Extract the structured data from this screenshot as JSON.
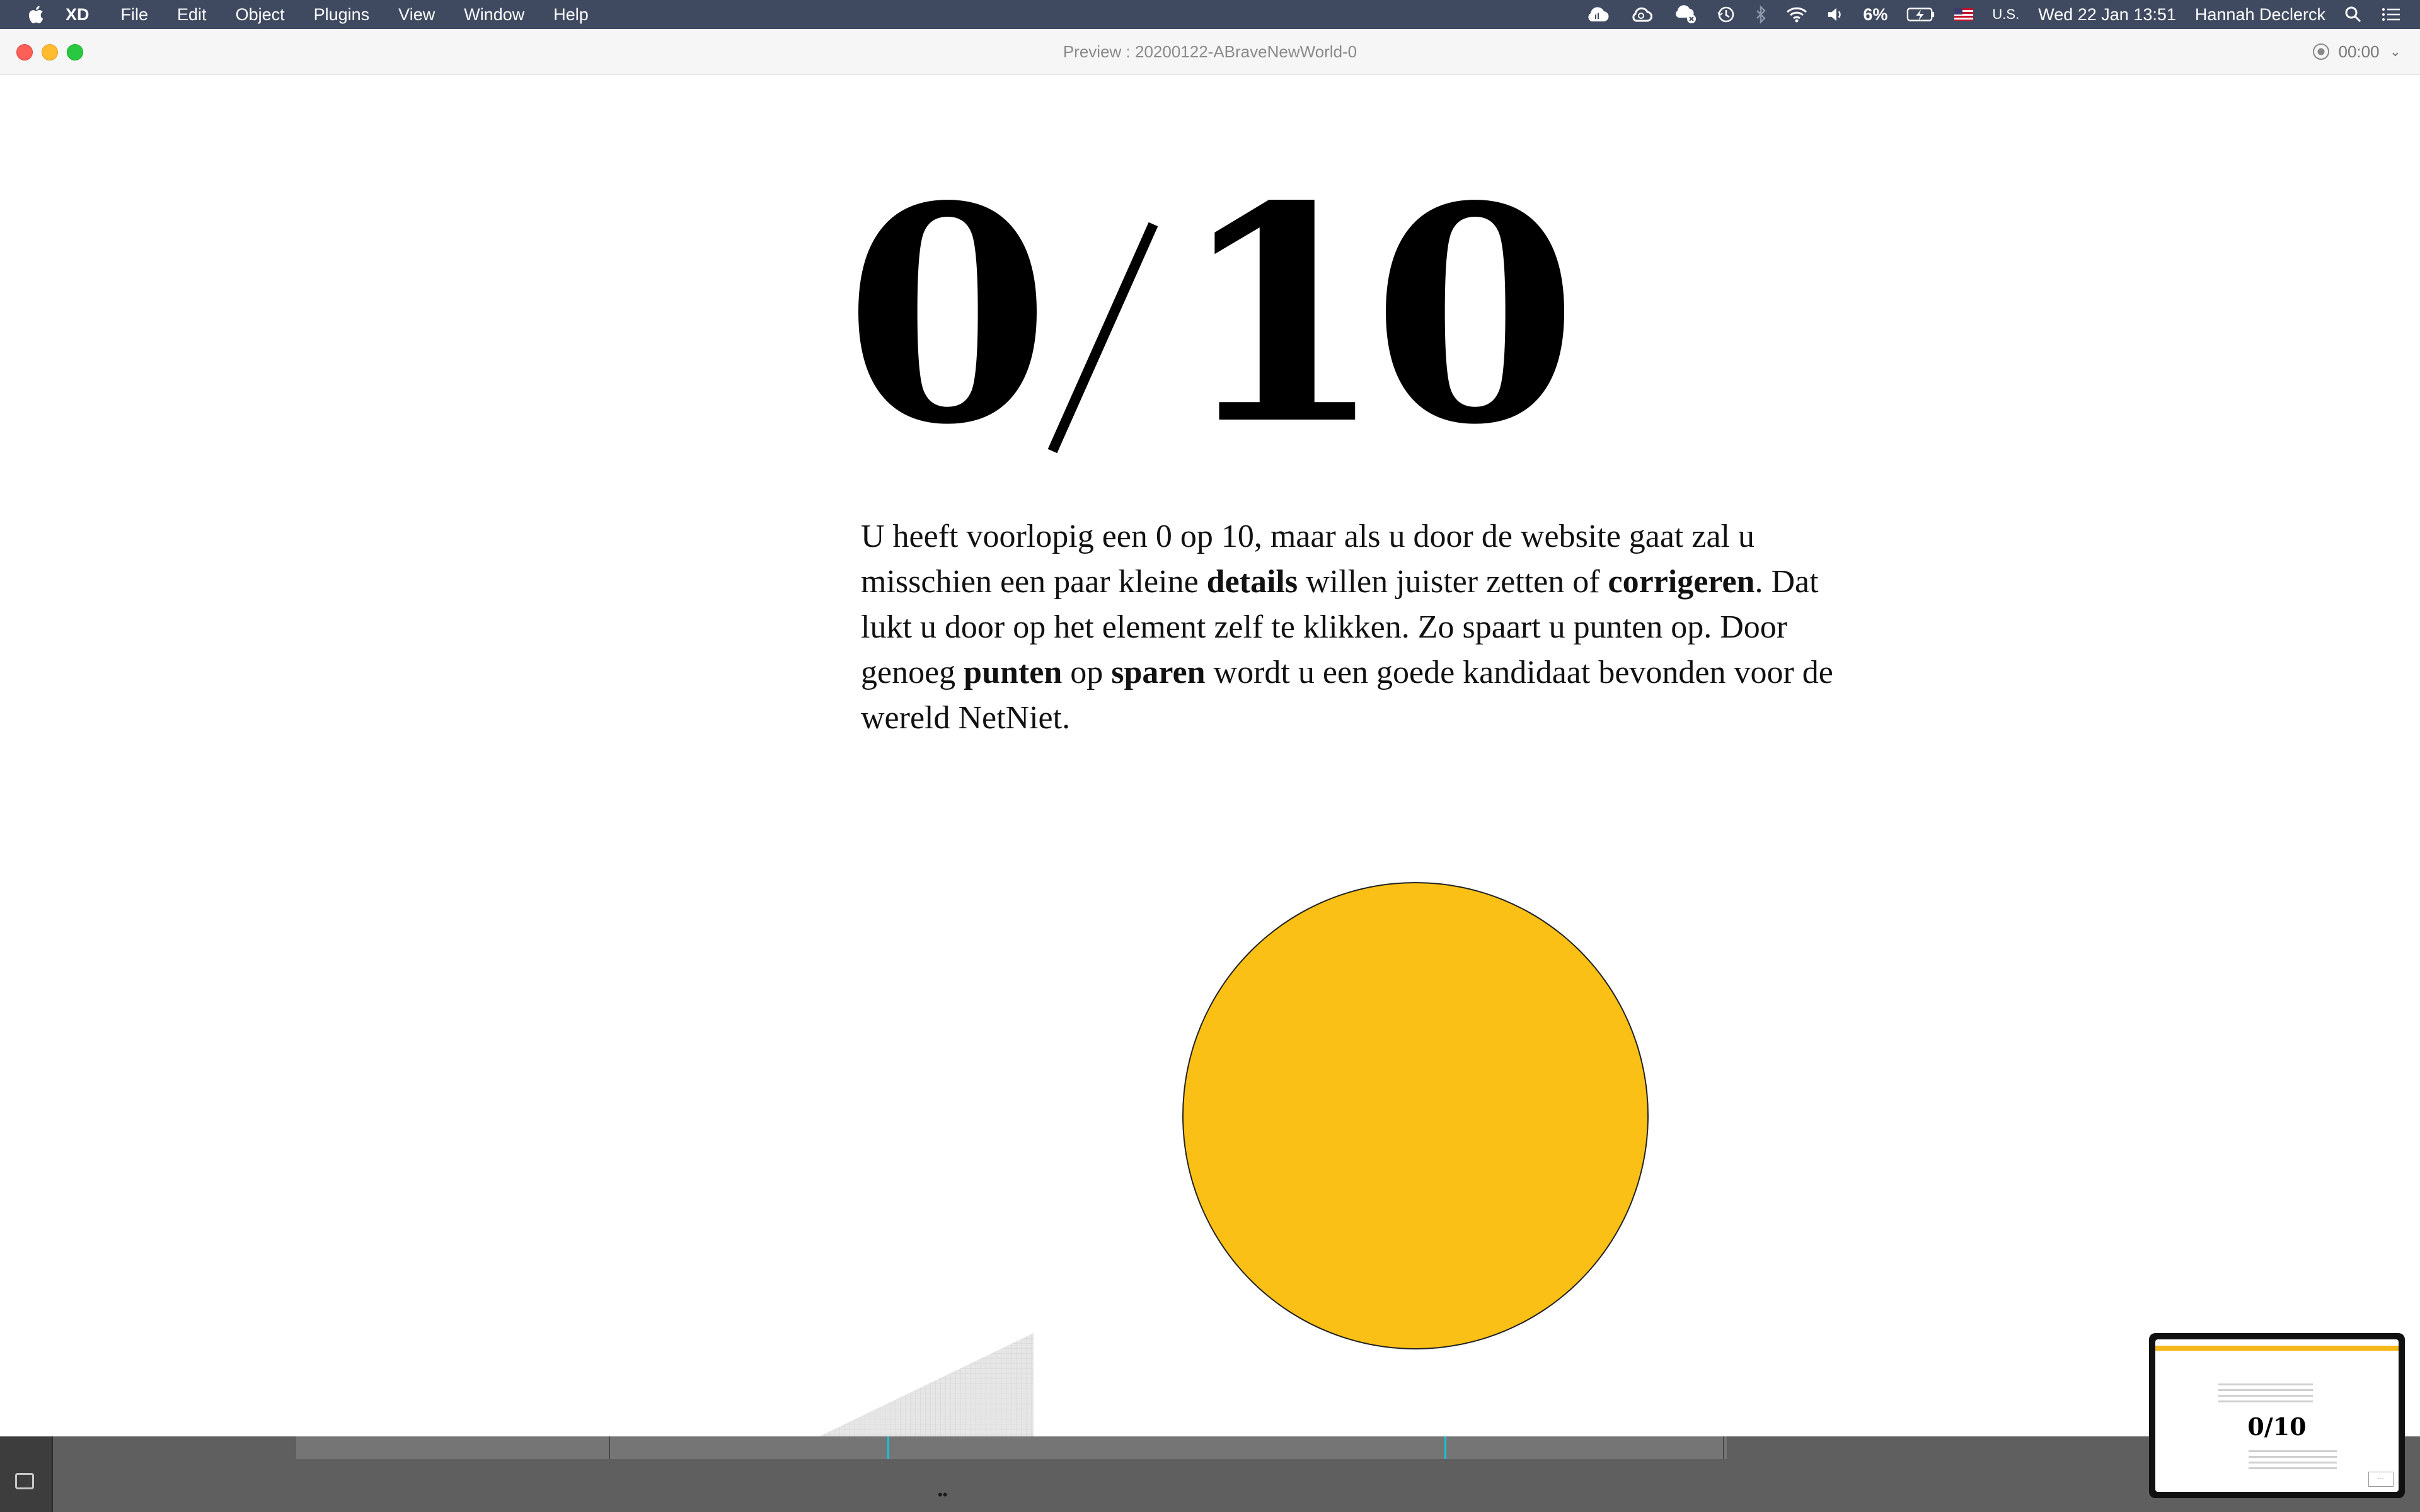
{
  "menubar": {
    "app_name": "XD",
    "menus": [
      "File",
      "Edit",
      "Object",
      "Plugins",
      "View",
      "Window",
      "Help"
    ],
    "battery": "6%",
    "input_source": "U.S.",
    "datetime": "Wed 22 Jan  13:51",
    "user": "Hannah Declerck"
  },
  "window": {
    "title": "Preview : 20200122-ABraveNewWorld-0",
    "record_time": "00:00"
  },
  "content": {
    "score": "0/10",
    "score_parts": {
      "left": "0",
      "right": "10"
    },
    "paragraph": {
      "t1": "U heeft voorlopig een 0 op 10, maar als u door de website gaat zal u misschien een paar kleine ",
      "b1": "details",
      "t2": " willen juister zetten of ",
      "b2": "corrigeren",
      "t3": ". Dat lukt u door op het element zelf te klikken. Zo spaart u punten op. Door genoeg ",
      "b3": "punten",
      "t4": " op ",
      "b4": "sparen",
      "t5": " wordt u een goede kandidaat bevonden voor de wereld NetNiet."
    },
    "circle_color": "#fac016"
  },
  "thumbnail": {
    "score": "0/10"
  }
}
